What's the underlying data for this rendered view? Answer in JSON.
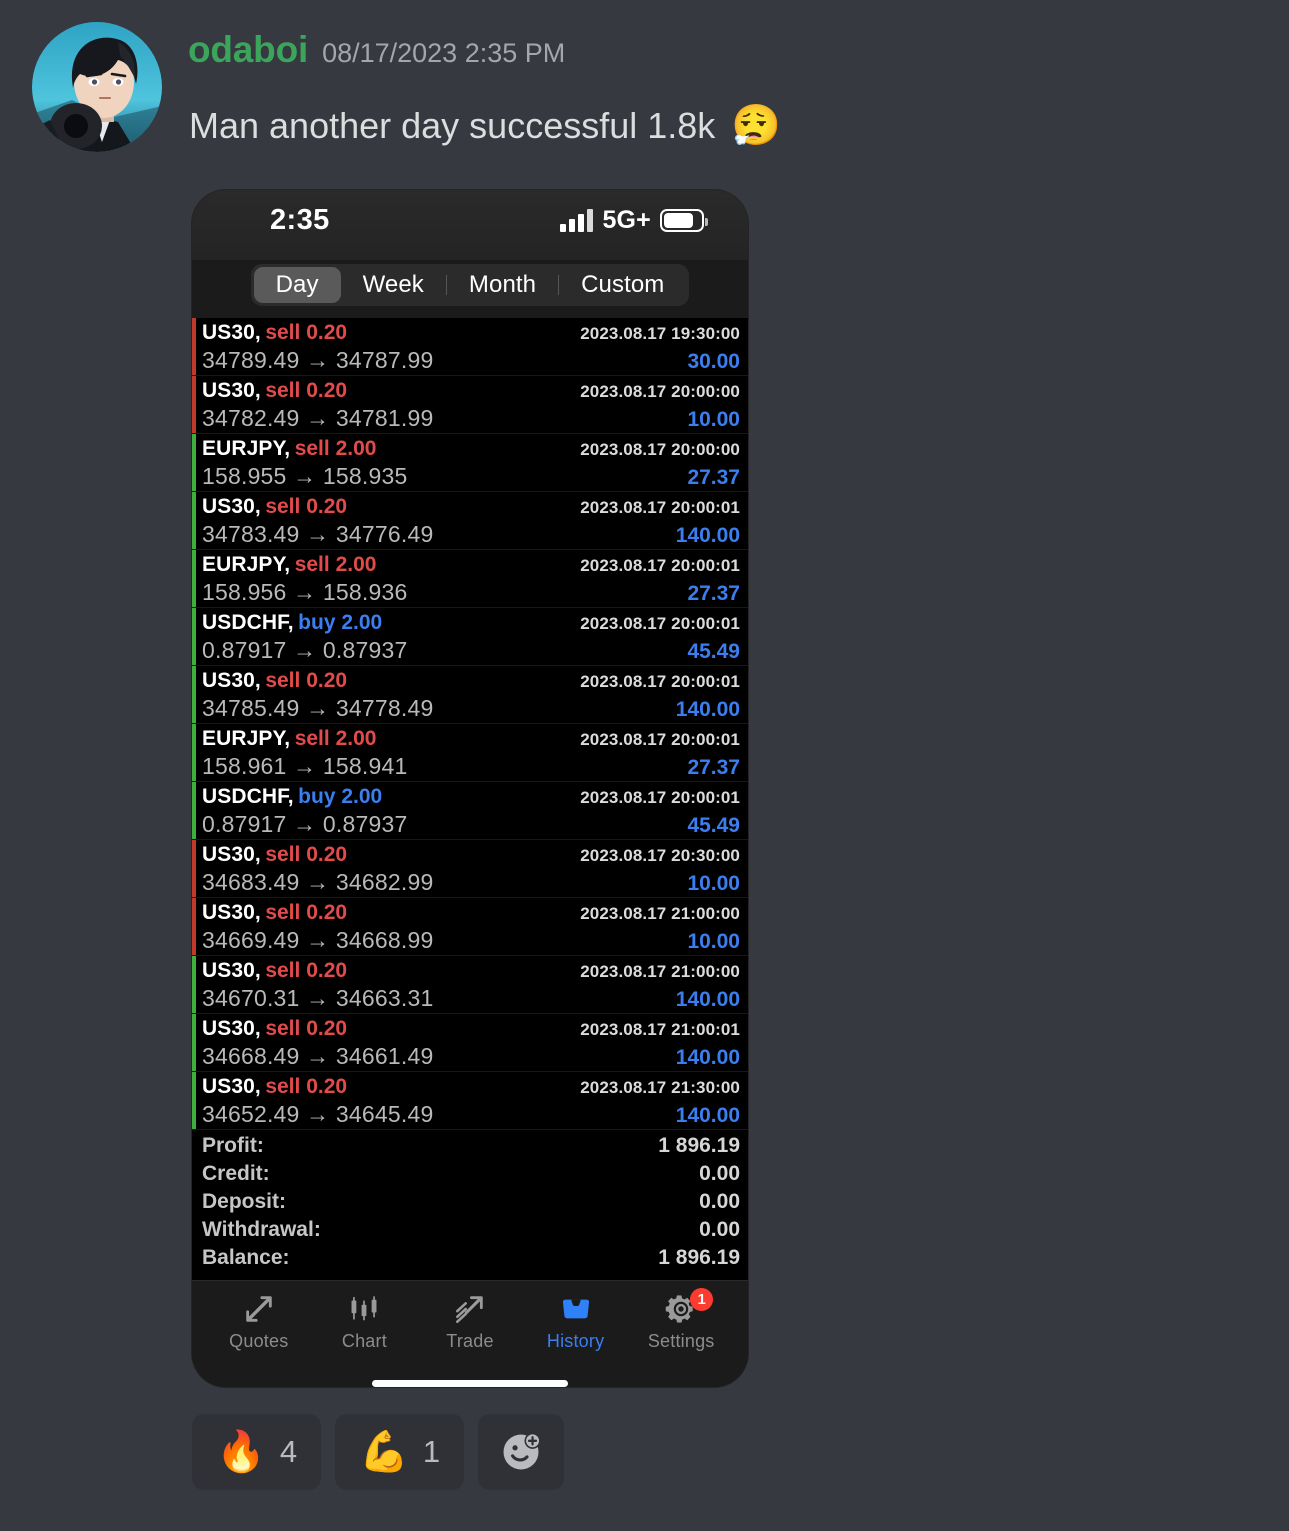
{
  "message": {
    "username": "odaboi",
    "timestamp": "08/17/2023 2:35 PM",
    "text": "Man another day successful 1.8k",
    "emoji": "😮‍💨",
    "username_color": "#3ba55c"
  },
  "phone": {
    "statusbar": {
      "time": "2:35",
      "network": "5G+"
    },
    "segments": [
      {
        "label": "Day",
        "active": true
      },
      {
        "label": "Week",
        "active": false
      },
      {
        "label": "Month",
        "active": false
      },
      {
        "label": "Custom",
        "active": false
      }
    ],
    "trades": [
      {
        "symbol": "US30,",
        "action": "sell",
        "volume": "0.20",
        "time": "2023.08.17 19:30:00",
        "open": "34789.49",
        "close": "34787.99",
        "profit": "30.00",
        "bar": "down"
      },
      {
        "symbol": "US30,",
        "action": "sell",
        "volume": "0.20",
        "time": "2023.08.17 20:00:00",
        "open": "34782.49",
        "close": "34781.99",
        "profit": "10.00",
        "bar": "down"
      },
      {
        "symbol": "EURJPY,",
        "action": "sell",
        "volume": "2.00",
        "time": "2023.08.17 20:00:00",
        "open": "158.955",
        "close": "158.935",
        "profit": "27.37",
        "bar": "up"
      },
      {
        "symbol": "US30,",
        "action": "sell",
        "volume": "0.20",
        "time": "2023.08.17 20:00:01",
        "open": "34783.49",
        "close": "34776.49",
        "profit": "140.00",
        "bar": "up"
      },
      {
        "symbol": "EURJPY,",
        "action": "sell",
        "volume": "2.00",
        "time": "2023.08.17 20:00:01",
        "open": "158.956",
        "close": "158.936",
        "profit": "27.37",
        "bar": "up"
      },
      {
        "symbol": "USDCHF,",
        "action": "buy",
        "volume": "2.00",
        "time": "2023.08.17 20:00:01",
        "open": "0.87917",
        "close": "0.87937",
        "profit": "45.49",
        "bar": "up"
      },
      {
        "symbol": "US30,",
        "action": "sell",
        "volume": "0.20",
        "time": "2023.08.17 20:00:01",
        "open": "34785.49",
        "close": "34778.49",
        "profit": "140.00",
        "bar": "up"
      },
      {
        "symbol": "EURJPY,",
        "action": "sell",
        "volume": "2.00",
        "time": "2023.08.17 20:00:01",
        "open": "158.961",
        "close": "158.941",
        "profit": "27.37",
        "bar": "up"
      },
      {
        "symbol": "USDCHF,",
        "action": "buy",
        "volume": "2.00",
        "time": "2023.08.17 20:00:01",
        "open": "0.87917",
        "close": "0.87937",
        "profit": "45.49",
        "bar": "up"
      },
      {
        "symbol": "US30,",
        "action": "sell",
        "volume": "0.20",
        "time": "2023.08.17 20:30:00",
        "open": "34683.49",
        "close": "34682.99",
        "profit": "10.00",
        "bar": "down"
      },
      {
        "symbol": "US30,",
        "action": "sell",
        "volume": "0.20",
        "time": "2023.08.17 21:00:00",
        "open": "34669.49",
        "close": "34668.99",
        "profit": "10.00",
        "bar": "down"
      },
      {
        "symbol": "US30,",
        "action": "sell",
        "volume": "0.20",
        "time": "2023.08.17 21:00:00",
        "open": "34670.31",
        "close": "34663.31",
        "profit": "140.00",
        "bar": "up"
      },
      {
        "symbol": "US30,",
        "action": "sell",
        "volume": "0.20",
        "time": "2023.08.17 21:00:01",
        "open": "34668.49",
        "close": "34661.49",
        "profit": "140.00",
        "bar": "up"
      },
      {
        "symbol": "US30,",
        "action": "sell",
        "volume": "0.20",
        "time": "2023.08.17 21:30:00",
        "open": "34652.49",
        "close": "34645.49",
        "profit": "140.00",
        "bar": "up"
      }
    ],
    "summary": [
      {
        "label": "Profit:",
        "value": "1 896.19"
      },
      {
        "label": "Credit:",
        "value": "0.00"
      },
      {
        "label": "Deposit:",
        "value": "0.00"
      },
      {
        "label": "Withdrawal:",
        "value": "0.00"
      },
      {
        "label": "Balance:",
        "value": "1 896.19"
      }
    ],
    "tabs": [
      {
        "label": "Quotes",
        "icon": "quotes-arrows-icon",
        "active": false,
        "badge": ""
      },
      {
        "label": "Chart",
        "icon": "candlestick-icon",
        "active": false,
        "badge": ""
      },
      {
        "label": "Trade",
        "icon": "trend-arrow-icon",
        "active": false,
        "badge": ""
      },
      {
        "label": "History",
        "icon": "inbox-icon",
        "active": true,
        "badge": ""
      },
      {
        "label": "Settings",
        "icon": "gear-icon",
        "active": false,
        "badge": "1"
      }
    ],
    "arrow": "→",
    "colors": {
      "buy": "#3b7ef0",
      "sell": "#e24b4b",
      "profit": "#3b7ef0",
      "bar_up": "#3eae3e",
      "bar_down": "#c0392b"
    }
  },
  "reactions": [
    {
      "emoji": "🔥",
      "count": "4",
      "name": "fire"
    },
    {
      "emoji": "💪",
      "count": "1",
      "name": "flexed-biceps"
    }
  ],
  "add_reaction": {
    "label": "add-reaction"
  }
}
